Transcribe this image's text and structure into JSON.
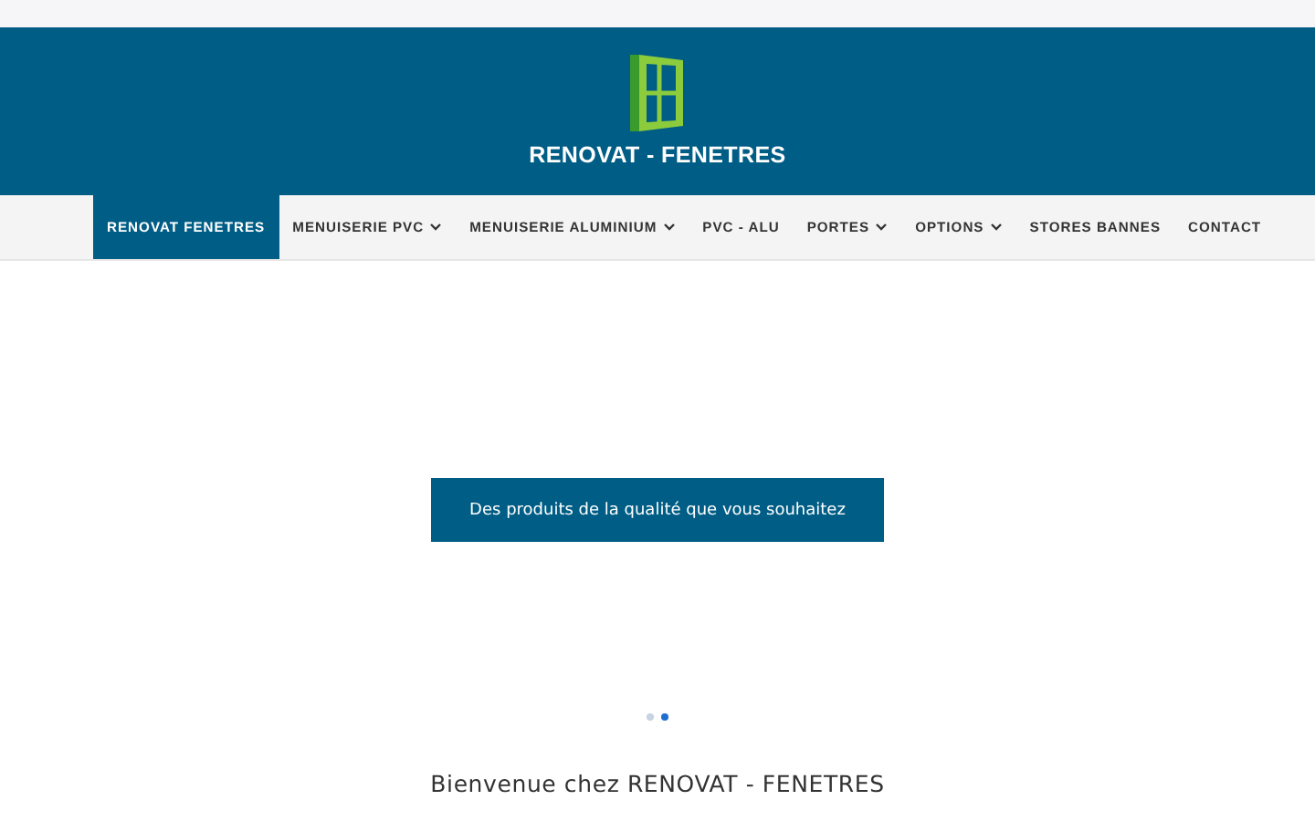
{
  "header": {
    "logo_text": "RENOVAT - FENETRES"
  },
  "nav": [
    {
      "label": "RENOVAT FENETRES",
      "selected": true,
      "dropdown": false
    },
    {
      "label": "MENUISERIE PVC",
      "selected": false,
      "dropdown": true
    },
    {
      "label": "MENUISERIE ALUMINIUM",
      "selected": false,
      "dropdown": true
    },
    {
      "label": "PVC - ALU",
      "selected": false,
      "dropdown": false
    },
    {
      "label": "PORTES",
      "selected": false,
      "dropdown": true
    },
    {
      "label": "OPTIONS",
      "selected": false,
      "dropdown": true
    },
    {
      "label": "STORES BANNES",
      "selected": false,
      "dropdown": false
    },
    {
      "label": "CONTACT",
      "selected": false,
      "dropdown": false
    }
  ],
  "slider": {
    "caption": "Des produits de la qualité que vous souhaitez",
    "dots": [
      {
        "selected": false
      },
      {
        "selected": true
      }
    ]
  },
  "welcome_heading": "Bienvenue chez RENOVAT - FENETRES"
}
